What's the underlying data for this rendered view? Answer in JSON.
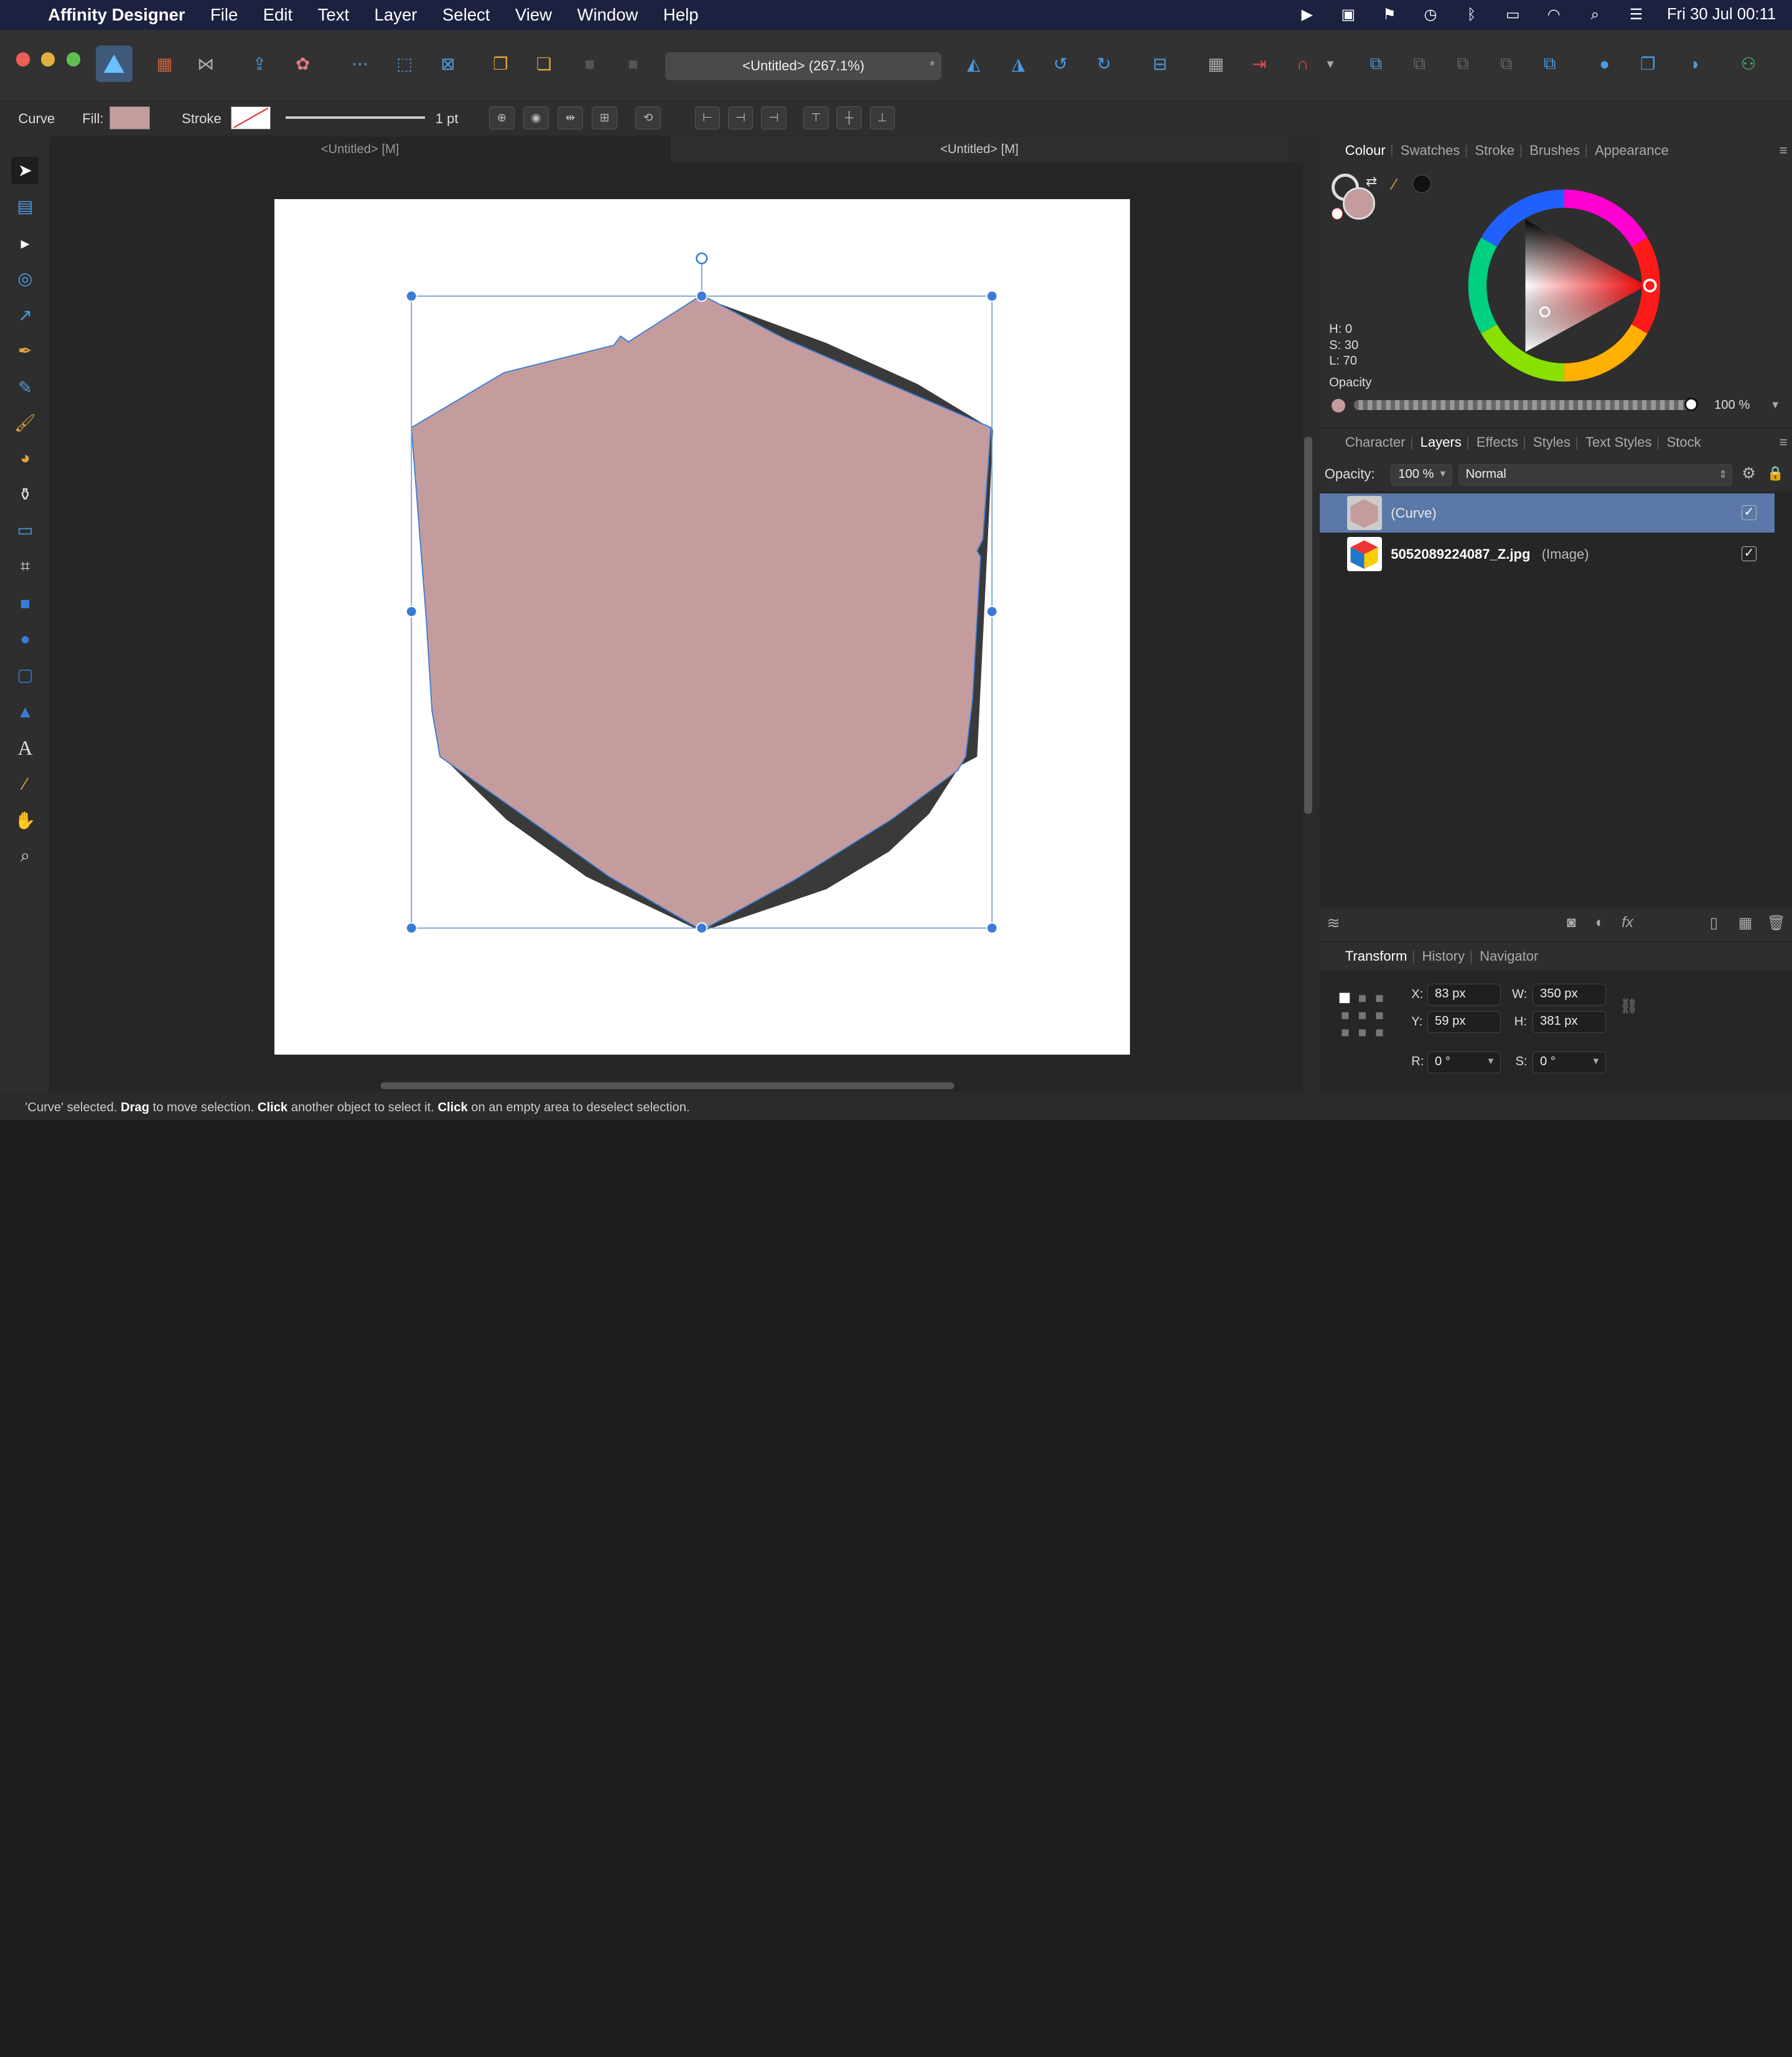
{
  "menubar": {
    "app_name": "Affinity Designer",
    "items": [
      "File",
      "Edit",
      "Text",
      "Layer",
      "Select",
      "View",
      "Window",
      "Help"
    ],
    "datetime": "Fri 30 Jul  00:11"
  },
  "toolbar": {
    "doc_title": "<Untitled> (267.1%)",
    "doc_close": "*"
  },
  "context": {
    "tool_label": "Curve",
    "fill_label": "Fill:",
    "stroke_label": "Stroke",
    "stroke_width": "1 pt",
    "fill_color": "#c49c9d"
  },
  "tabs": [
    "<Untitled> [M]",
    "<Untitled> [M]"
  ],
  "colour_panel": {
    "tabs": [
      "Colour",
      "Swatches",
      "Stroke",
      "Brushes",
      "Appearance"
    ],
    "h": "H: 0",
    "s": "S: 30",
    "l": "L: 70",
    "opacity_label": "Opacity",
    "opacity_value": "100 %"
  },
  "layers_panel": {
    "tabs": [
      "Character",
      "Layers",
      "Effects",
      "Styles",
      "Text Styles",
      "Stock"
    ],
    "opacity_label": "Opacity:",
    "opacity_value": "100 %",
    "blend_mode": "Normal",
    "layers": [
      {
        "name": "(Curve)",
        "type": "",
        "checked": "✓"
      },
      {
        "name": "5052089224087_Z.jpg",
        "type": "(Image)",
        "checked": "✓"
      }
    ]
  },
  "transform_panel": {
    "tabs": [
      "Transform",
      "History",
      "Navigator"
    ],
    "x_label": "X:",
    "x": "83 px",
    "y_label": "Y:",
    "y": "59 px",
    "w_label": "W:",
    "w": "350 px",
    "h_label": "H:",
    "h": "381 px",
    "r_label": "R:",
    "r": "0 °",
    "s_label": "S:",
    "s": "0 °"
  },
  "status": {
    "p1": "'Curve' selected. ",
    "b1": "Drag",
    "p2": " to move selection. ",
    "b2": "Click",
    "p3": " another object to select it. ",
    "b3": "Click",
    "p4": " on an empty area to deselect selection."
  },
  "colors": {
    "accent": "#3a7bd5",
    "selection_row": "#5b78a8",
    "shape_fill": "#c49c9d"
  }
}
